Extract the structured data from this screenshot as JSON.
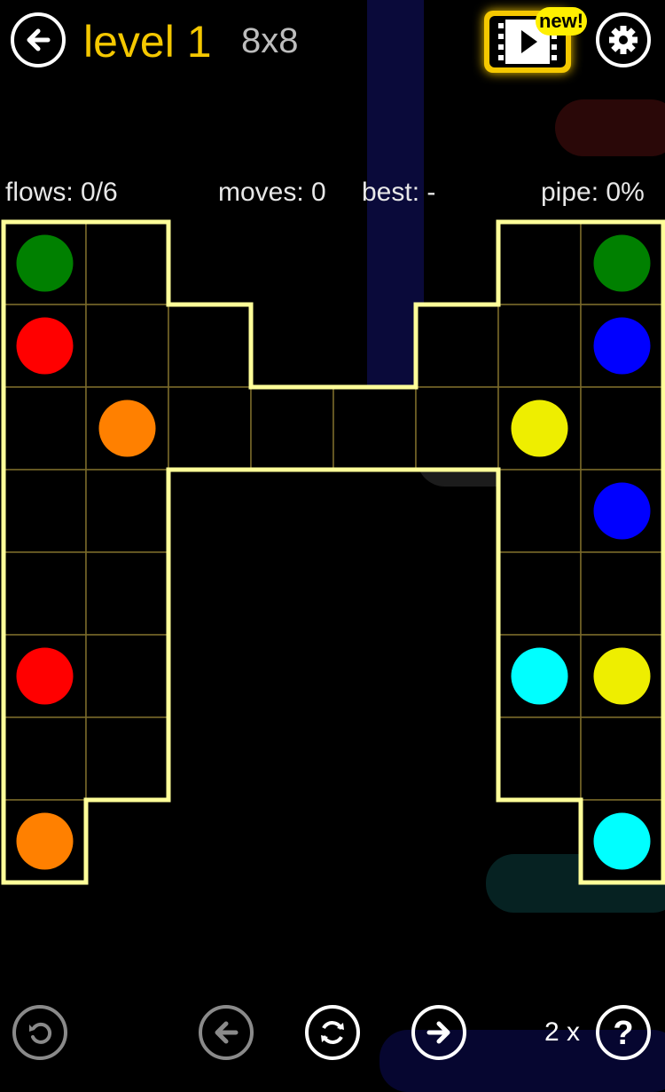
{
  "header": {
    "level_label": "level 1",
    "size_label": "8x8",
    "new_badge": "new!"
  },
  "stats": {
    "flows": "flows: 0/6",
    "moves": "moves: 0",
    "best": "best: -",
    "pipe": "pipe: 0%"
  },
  "colors": {
    "green": "#008000",
    "red": "#ff0000",
    "blue": "#0000ff",
    "orange": "#ff8000",
    "yellow": "#eeee00",
    "cyan": "#00ffff",
    "accent": "#f5c800",
    "grid_line": "#7a6a2a",
    "board_border": "#ffff99"
  },
  "board": {
    "rows": 8,
    "cols": 8,
    "cells": [
      "XX..XX",
      "X....X",
      "........",
      "XX....XX",
      "XX....XX",
      "XX....XX",
      "XX....XX",
      "X......X"
    ],
    "_note": "",
    "dots": [
      {
        "color": "green",
        "row": 0,
        "col": 0
      },
      {
        "color": "green",
        "row": 0,
        "col": 7
      },
      {
        "color": "red",
        "row": 1,
        "col": 0
      },
      {
        "color": "blue",
        "row": 1,
        "col": 7
      },
      {
        "color": "orange",
        "row": 2,
        "col": 1
      },
      {
        "color": "yellow",
        "row": 2,
        "col": 6
      },
      {
        "color": "blue",
        "row": 3,
        "col": 7
      },
      {
        "color": "red",
        "row": 5,
        "col": 0
      },
      {
        "color": "cyan",
        "row": 5,
        "col": 6
      },
      {
        "color": "yellow",
        "row": 5,
        "col": 7
      },
      {
        "color": "orange",
        "row": 7,
        "col": 0
      },
      {
        "color": "cyan",
        "row": 7,
        "col": 7
      }
    ]
  },
  "footer": {
    "hint_count": "2 x"
  }
}
